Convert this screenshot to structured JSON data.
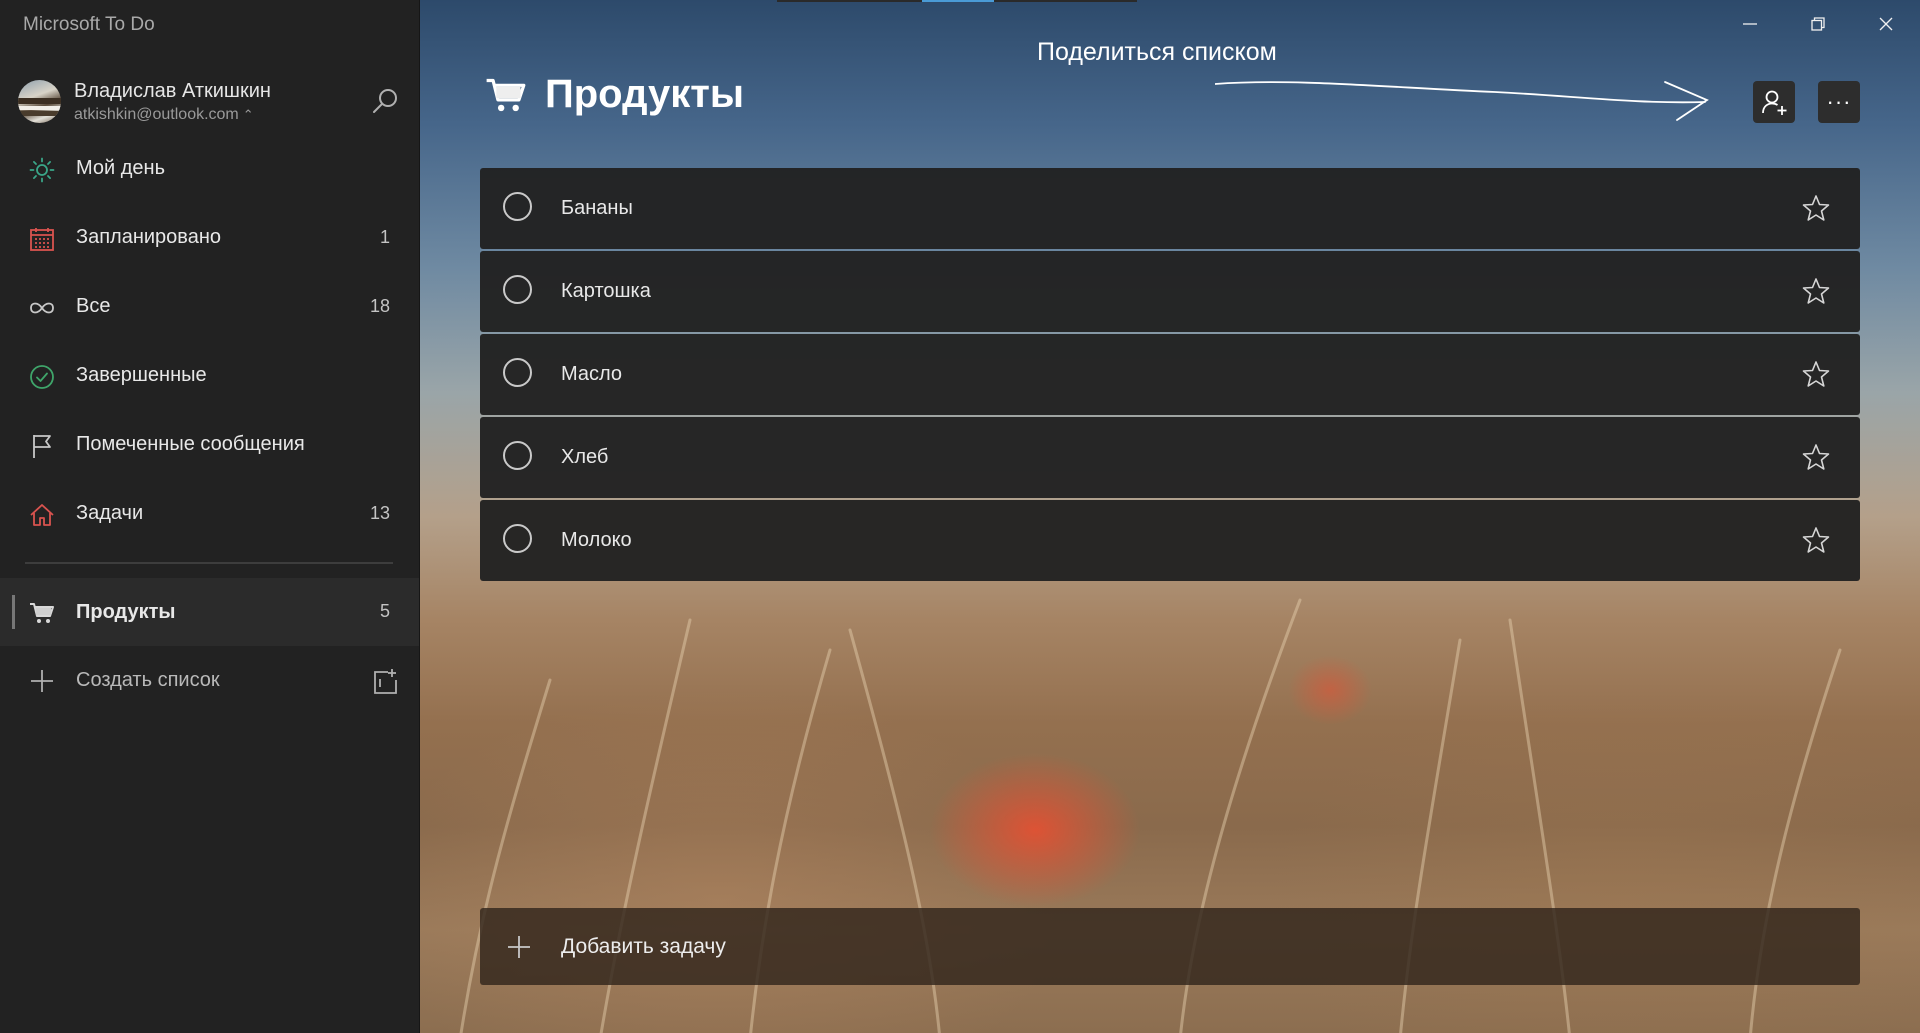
{
  "app": {
    "title": "Microsoft To Do"
  },
  "profile": {
    "name": "Владислав Аткишкин",
    "email": "atkishkin@outlook.com",
    "email_chevron": "⌃⌄"
  },
  "sidebar": {
    "items": [
      {
        "label": "Мой день",
        "count": "",
        "icon": "sun-icon",
        "icon_color": "#3aa688"
      },
      {
        "label": "Запланировано",
        "count": "1",
        "icon": "calendar-icon",
        "icon_color": "#d9534f"
      },
      {
        "label": "Все",
        "count": "18",
        "icon": "infinity-icon",
        "icon_color": "#c8c8c8"
      },
      {
        "label": "Завершенные",
        "count": "",
        "icon": "check-circle-icon",
        "icon_color": "#3fa56a"
      },
      {
        "label": "Помеченные сообщения",
        "count": "",
        "icon": "flag-icon",
        "icon_color": "#c8c8c8"
      },
      {
        "label": "Задачи",
        "count": "13",
        "icon": "home-icon",
        "icon_color": "#d9534f"
      }
    ],
    "lists": [
      {
        "label": "Продукты",
        "count": "5",
        "icon": "cart-icon"
      }
    ],
    "create_list_label": "Создать список"
  },
  "main": {
    "list_title": "Продукты",
    "share_annotation": "Поделиться списком",
    "more_label": "···",
    "tasks": [
      {
        "title": "Бананы"
      },
      {
        "title": "Картошка"
      },
      {
        "title": "Масло"
      },
      {
        "title": "Хлеб"
      },
      {
        "title": "Молоко"
      }
    ],
    "add_task_label": "Добавить задачу"
  }
}
